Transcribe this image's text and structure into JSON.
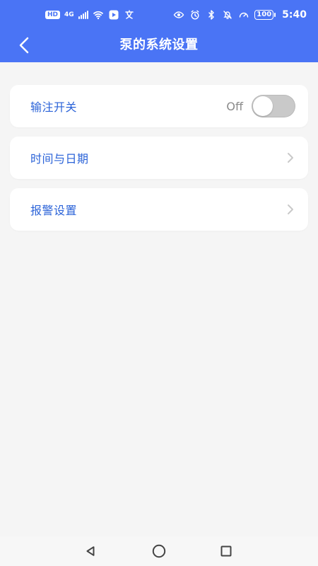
{
  "status_bar": {
    "left_badges": [
      "HD",
      "4G"
    ],
    "wifi_icon": "wifi-icon",
    "app_icon": "play-store-icon",
    "lang_icon": "translate-icon",
    "right_icons": [
      "eye-icon",
      "alarm-icon",
      "bluetooth-icon",
      "mute-icon",
      "speed-icon"
    ],
    "battery": "100",
    "time": "5:40"
  },
  "nav": {
    "back_icon": "chevron-left-icon",
    "title": "泵的系统设置"
  },
  "colors": {
    "header": "#4a74f5",
    "label": "#2b63d8",
    "background": "#f5f5f5",
    "card": "#ffffff",
    "toggle_off": "#c9c9c9"
  },
  "settings": {
    "items": [
      {
        "label": "输注开关",
        "type": "toggle",
        "toggle_text": "Off",
        "value": false
      },
      {
        "label": "时间与日期",
        "type": "navigation",
        "icon": "chevron-right-icon"
      },
      {
        "label": "报警设置",
        "type": "navigation",
        "icon": "chevron-right-icon"
      }
    ]
  },
  "system_nav": {
    "back": "triangle-back-icon",
    "home": "circle-home-icon",
    "recent": "square-recent-icon"
  }
}
